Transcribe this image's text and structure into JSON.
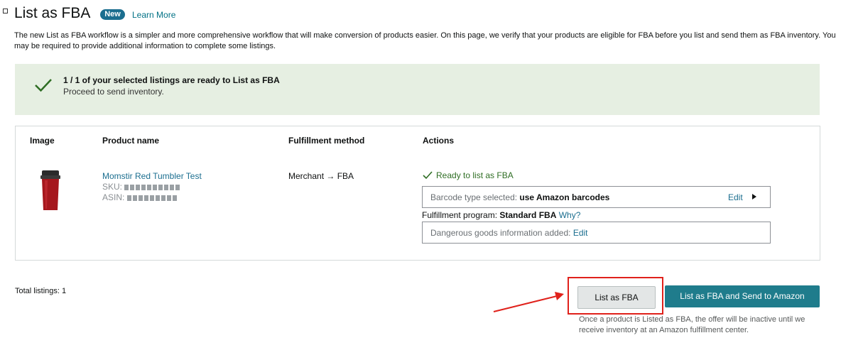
{
  "header": {
    "title": "List as FBA",
    "badge": "New",
    "learn_more": "Learn More",
    "description": "The new List as FBA workflow is a simpler and more comprehensive workflow that will make conversion of products easier. On this page, we verify that your products are eligible for FBA before you list and send them as FBA inventory. You may be required to provide additional information to complete some listings."
  },
  "banner": {
    "title": "1 / 1 of your selected listings are ready to List as FBA",
    "subtitle": "Proceed to send inventory."
  },
  "table": {
    "columns": [
      "Image",
      "Product name",
      "Fulfillment method",
      "Actions"
    ],
    "rows": [
      {
        "product_name": "Momstir Red Tumbler Test",
        "sku_label": "SKU:",
        "asin_label": "ASIN:",
        "fulfillment_method": "Merchant → FBA",
        "status": "Ready to list as FBA",
        "barcode_label": "Barcode type selected:",
        "barcode_value": "use Amazon barcodes",
        "edit_label": "Edit",
        "program_label": "Fulfillment program:",
        "program_value": "Standard FBA",
        "why_label": "Why?",
        "dg_label": "Dangerous goods information added:",
        "dg_edit": "Edit"
      }
    ]
  },
  "footer": {
    "total_listings": "Total listings: 1",
    "list_button": "List as FBA",
    "list_send_button": "List as FBA and Send to Amazon",
    "note": "Once a product is Listed as FBA, the offer will be inactive until we receive inventory at an Amazon fulfillment center."
  },
  "colors": {
    "accent": "#1f7c8c",
    "link": "#1b6e8f",
    "banner_bg": "#e6efe2",
    "success": "#2f6e24",
    "annotation": "#e0211b"
  }
}
